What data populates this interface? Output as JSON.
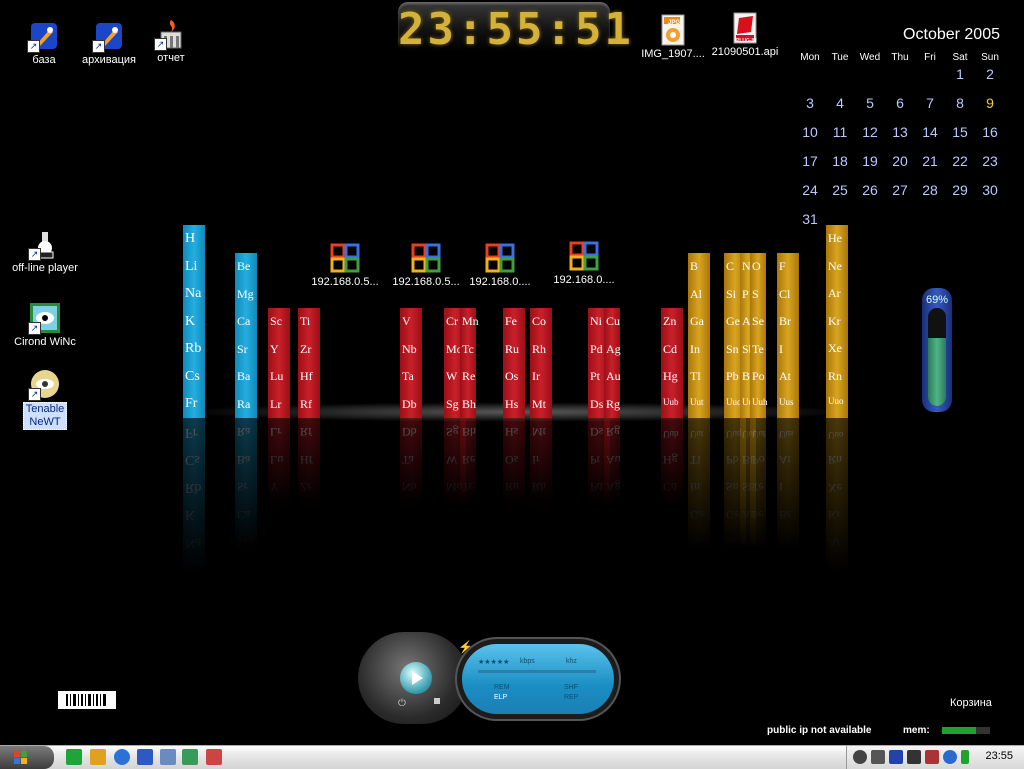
{
  "desktop": {
    "icons": [
      {
        "label": "база"
      },
      {
        "label": "архивация"
      },
      {
        "label": "отчет"
      },
      {
        "label": "IMG_1907...."
      },
      {
        "label": "21090501.api"
      },
      {
        "label": "off-line player"
      },
      {
        "label": "Cirond WiNc"
      },
      {
        "label": "Tenable NeWT"
      },
      {
        "label": "192.168.0.5..."
      },
      {
        "label": "192.168.0.5..."
      },
      {
        "label": "192.168.0...."
      },
      {
        "label": "192.168.0...."
      }
    ],
    "jpg_badge": "JPG",
    "plugin_badge": "PLUG-IN",
    "recycle_bin_label": "Корзина"
  },
  "clock_widget": {
    "time": "23:55:51"
  },
  "calendar": {
    "title": "October 2005",
    "weekdays": [
      "Mon",
      "Tue",
      "Wed",
      "Thu",
      "Fri",
      "Sat",
      "Sun"
    ],
    "today": "9",
    "weeks": [
      [
        "",
        "",
        "",
        "",
        "",
        "1",
        "2"
      ],
      [
        "3",
        "4",
        "5",
        "6",
        "7",
        "8",
        "9"
      ],
      [
        "10",
        "11",
        "12",
        "13",
        "14",
        "15",
        "16"
      ],
      [
        "17",
        "18",
        "19",
        "20",
        "21",
        "22",
        "23"
      ],
      [
        "24",
        "25",
        "26",
        "27",
        "28",
        "29",
        "30"
      ],
      [
        "31",
        "",
        "",
        "",
        "",
        "",
        ""
      ]
    ]
  },
  "periodic_chart": {
    "columns": [
      {
        "color": "blue",
        "elements": [
          "H",
          "Li",
          "Na",
          "K",
          "Rb",
          "Cs",
          "Fr"
        ]
      },
      {
        "color": "blue",
        "elements": [
          "Be",
          "Mg",
          "Ca",
          "Sr",
          "Ba",
          "Ra"
        ]
      },
      {
        "color": "red",
        "elements": [
          "Sc",
          "Y",
          "Lu",
          "Lr"
        ]
      },
      {
        "color": "red",
        "elements": [
          "Ti",
          "Zr",
          "Hf",
          "Rf"
        ]
      },
      {
        "color": "red",
        "elements": [
          "V",
          "Nb",
          "Ta",
          "Db"
        ]
      },
      {
        "color": "red",
        "elements": [
          "Cr",
          "Mo",
          "W",
          "Sg"
        ]
      },
      {
        "color": "red",
        "elements": [
          "Mn",
          "Tc",
          "Re",
          "Bh"
        ]
      },
      {
        "color": "red",
        "elements": [
          "Fe",
          "Ru",
          "Os",
          "Hs"
        ]
      },
      {
        "color": "red",
        "elements": [
          "Co",
          "Rh",
          "Ir",
          "Mt"
        ]
      },
      {
        "color": "red",
        "elements": [
          "Ni",
          "Pd",
          "Pt",
          "Ds"
        ]
      },
      {
        "color": "red",
        "elements": [
          "Cu",
          "Ag",
          "Au",
          "Rg"
        ]
      },
      {
        "color": "red",
        "elements": [
          "Zn",
          "Cd",
          "Hg",
          "Uub"
        ]
      },
      {
        "color": "gold",
        "elements": [
          "B",
          "Al",
          "Ga",
          "In",
          "Tl",
          "Uut"
        ]
      },
      {
        "color": "gold",
        "elements": [
          "C",
          "Si",
          "Ge",
          "Sn",
          "Pb",
          "Uuq"
        ]
      },
      {
        "color": "gold",
        "elements": [
          "N",
          "P",
          "As",
          "Sb",
          "Bi",
          "Uup"
        ]
      },
      {
        "color": "gold",
        "elements": [
          "O",
          "S",
          "Se",
          "Te",
          "Po",
          "Uuh"
        ]
      },
      {
        "color": "gold",
        "elements": [
          "F",
          "Cl",
          "Br",
          "I",
          "At",
          "Uus"
        ]
      },
      {
        "color": "gold",
        "elements": [
          "He",
          "Ne",
          "Ar",
          "Kr",
          "Xe",
          "Rn",
          "Uuo"
        ]
      }
    ],
    "colors": {
      "blue": "#1ea0d4",
      "red": "#c01a24",
      "gold": "#d4a020"
    }
  },
  "gauge": {
    "label": "69%",
    "value": 0.69
  },
  "player": {
    "kbps": "kbps",
    "khz": "khz",
    "rem": "REM",
    "elp": "ELP",
    "shf": "SHF",
    "rep": "REP",
    "stars": "★★★★★"
  },
  "status": {
    "ip": "public ip not available",
    "mem_label": "mem:",
    "mem_value": 0.7
  },
  "taskbar": {
    "quicklaunch": [
      "v-icon",
      "tools-icon",
      "ie-icon",
      "outlook-icon",
      "network-icon",
      "photo-icon"
    ],
    "tray_icons": [
      "volume-icon",
      "speaker-icon",
      "battery-icon",
      "k-icon",
      "network-icon",
      "help-icon",
      "status-icon"
    ],
    "clock": "23:55"
  }
}
